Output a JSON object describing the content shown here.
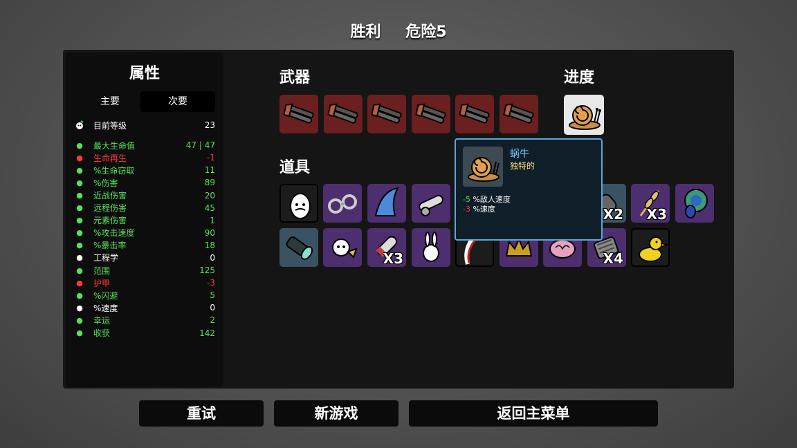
{
  "header": {
    "result": "胜利",
    "danger": "危险5"
  },
  "stats_panel": {
    "title": "属性",
    "tabs": [
      "主要",
      "次要"
    ],
    "level": {
      "label": "目前等级",
      "value": "23"
    },
    "rows": [
      {
        "label": "最大生命值",
        "value": "47 | 47",
        "color": "#59e05a",
        "icon": "heart-icon"
      },
      {
        "label": "生命再生",
        "value": "-1",
        "color": "#ff3a3a",
        "icon": "heal-icon"
      },
      {
        "label": "%生命窃取",
        "value": "11",
        "color": "#59e05a",
        "icon": "lifesteal-icon"
      },
      {
        "label": "%伤害",
        "value": "89",
        "color": "#59e05a",
        "icon": "damage-icon"
      },
      {
        "label": "近战伤害",
        "value": "20",
        "color": "#59e05a",
        "icon": "sword-icon"
      },
      {
        "label": "远程伤害",
        "value": "45",
        "color": "#59e05a",
        "icon": "bow-icon"
      },
      {
        "label": "元素伤害",
        "value": "1",
        "color": "#59e05a",
        "icon": "flame-icon"
      },
      {
        "label": "%攻击速度",
        "value": "90",
        "color": "#59e05a",
        "icon": "hourglass-icon"
      },
      {
        "label": "%暴击率",
        "value": "18",
        "color": "#59e05a",
        "icon": "crit-icon"
      },
      {
        "label": "工程学",
        "value": "0",
        "color": "#ffffff",
        "icon": "wrench-icon"
      },
      {
        "label": "范围",
        "value": "125",
        "color": "#59e05a",
        "icon": "range-icon"
      },
      {
        "label": "护甲",
        "value": "-3",
        "color": "#ff3a3a",
        "icon": "shield-icon"
      },
      {
        "label": "%闪避",
        "value": "5",
        "color": "#59e05a",
        "icon": "dodge-icon"
      },
      {
        "label": "%速度",
        "value": "0",
        "color": "#ffffff",
        "icon": "boot-icon"
      },
      {
        "label": "幸运",
        "value": "2",
        "color": "#59e05a",
        "icon": "dice-icon"
      },
      {
        "label": "收获",
        "value": "142",
        "color": "#59e05a",
        "icon": "harvest-icon"
      }
    ]
  },
  "sections": {
    "weapons": "武器",
    "items": "道具",
    "progress": "进度"
  },
  "weapons": [
    "double-barrel-gun-icon",
    "double-barrel-gun-icon",
    "double-barrel-gun-icon",
    "double-barrel-gun-icon",
    "double-barrel-gun-icon",
    "double-barrel-gun-icon"
  ],
  "items_row1": [
    {
      "icon": "egg-icon",
      "tier": "common",
      "count": ""
    },
    {
      "icon": "handcuffs-icon",
      "tier": "rare",
      "count": ""
    },
    {
      "icon": "shark-fin-icon",
      "tier": "rare",
      "count": ""
    },
    {
      "icon": "cannon-icon",
      "tier": "rare",
      "count": ""
    },
    {
      "icon": "rocket-icon",
      "tier": "uncommon",
      "count": "X2"
    },
    {
      "icon": "wheat-icon",
      "tier": "rare",
      "count": "X3"
    },
    {
      "icon": "peacock-icon",
      "tier": "rare",
      "count": ""
    }
  ],
  "items_row2": [
    {
      "icon": "flashlight-icon",
      "tier": "uncommon",
      "count": ""
    },
    {
      "icon": "cat-icon",
      "tier": "rare",
      "count": ""
    },
    {
      "icon": "missile-icon",
      "tier": "rare",
      "count": "X3"
    },
    {
      "icon": "rabbit-icon",
      "tier": "rare",
      "count": ""
    },
    {
      "icon": "claw-icon",
      "tier": "common",
      "count": ""
    },
    {
      "icon": "crown-icon",
      "tier": "rare",
      "count": ""
    },
    {
      "icon": "brain-icon",
      "tier": "rare",
      "count": ""
    },
    {
      "icon": "tread-icon",
      "tier": "rare",
      "count": "X4"
    },
    {
      "icon": "duck-icon",
      "tier": "common",
      "count": ""
    }
  ],
  "progress_item": "snail-icon",
  "tooltip": {
    "name": "蜗牛",
    "tag": "独特的",
    "effects": [
      {
        "value": "-5",
        "label": " %敌人速度",
        "color": "#59e05a"
      },
      {
        "value": "-3",
        "label": " %速度",
        "color": "#ff3a3a"
      }
    ]
  },
  "buttons": {
    "retry": "重试",
    "new_game": "新游戏",
    "main_menu": "返回主菜单"
  }
}
